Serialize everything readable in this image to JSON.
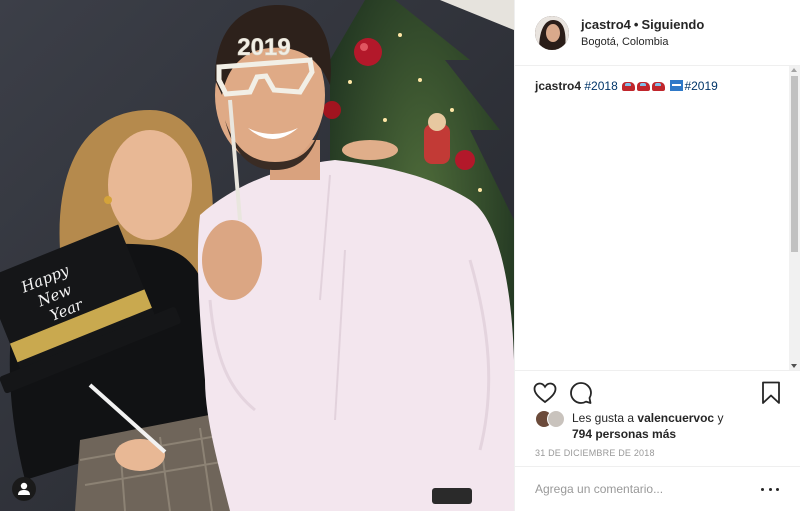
{
  "header": {
    "username": "jcastro4",
    "separator": "•",
    "follow_status": "Siguiendo",
    "location": "Bogotá, Colombia"
  },
  "photo": {
    "glasses_text": "2019",
    "sign_text": [
      "Happy",
      "New",
      "Year"
    ]
  },
  "caption": {
    "username": "jcastro4",
    "tag_1": "#2018",
    "emojis": [
      "red-car-emoji",
      "red-car-emoji",
      "red-car-emoji",
      "blue-flag-emoji"
    ],
    "tag_2": "#2019"
  },
  "likes": {
    "prefix": "Les gusta a",
    "liker": "valencuervoc",
    "connector": "y",
    "count_text": "794 personas más"
  },
  "date": "31 DE DICIEMBRE DE 2018",
  "comment": {
    "placeholder": "Agrega un comentario..."
  },
  "icons": {
    "like": "heart-icon",
    "comment": "comment-icon",
    "save": "bookmark-icon",
    "more": "more-options-icon",
    "tag": "user-tag-icon"
  },
  "colors": {
    "text": "#262626",
    "hashtag": "#003569",
    "muted": "#999999",
    "border": "#efefef"
  }
}
